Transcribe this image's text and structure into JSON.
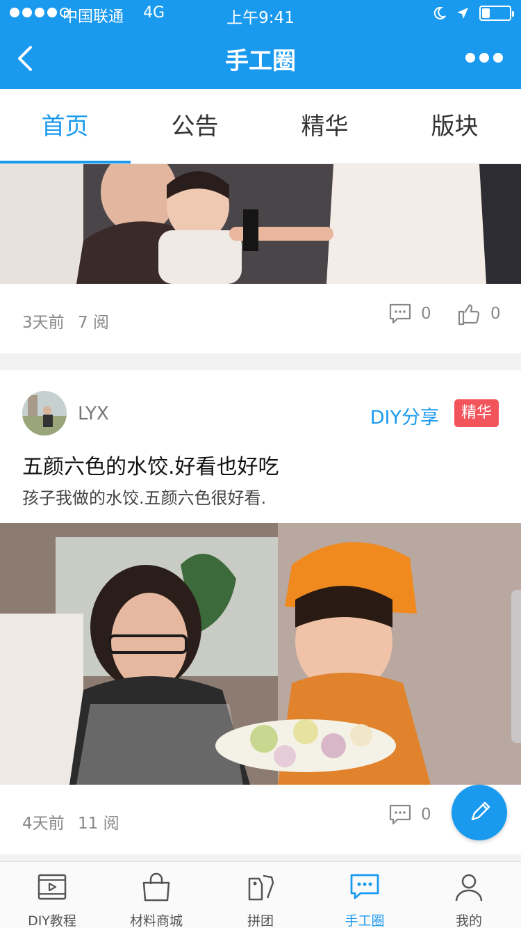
{
  "status_bar": {
    "carrier": "中国联通",
    "network": "4G",
    "time": "上午9:41",
    "battery_level": 0.3
  },
  "nav": {
    "title": "手工圈"
  },
  "tabs": [
    {
      "label": "首页",
      "active": true
    },
    {
      "label": "公告",
      "active": false
    },
    {
      "label": "精华",
      "active": false
    },
    {
      "label": "版块",
      "active": false
    }
  ],
  "posts": [
    {
      "time": "3天前",
      "reads": "7 阅",
      "comments": "0",
      "likes": "0"
    },
    {
      "author": "LYX",
      "category": "DIY分享",
      "badge": "精华",
      "title": "五颜六色的水饺.好看也好吃",
      "excerpt": "孩子我做的水饺.五颜六色很好看.",
      "time": "4天前",
      "reads": "11 阅",
      "comments": "0"
    }
  ],
  "tabbar": [
    {
      "label": "DIY教程",
      "icon": "video-icon",
      "active": false
    },
    {
      "label": "材料商城",
      "icon": "shopping-bag-icon",
      "active": false
    },
    {
      "label": "拼团",
      "icon": "tags-icon",
      "active": false
    },
    {
      "label": "手工圈",
      "icon": "chat-bubble-icon",
      "active": true
    },
    {
      "label": "我的",
      "icon": "user-icon",
      "active": false
    }
  ],
  "colors": {
    "accent": "#1a9aef",
    "badge": "#f2545b"
  }
}
